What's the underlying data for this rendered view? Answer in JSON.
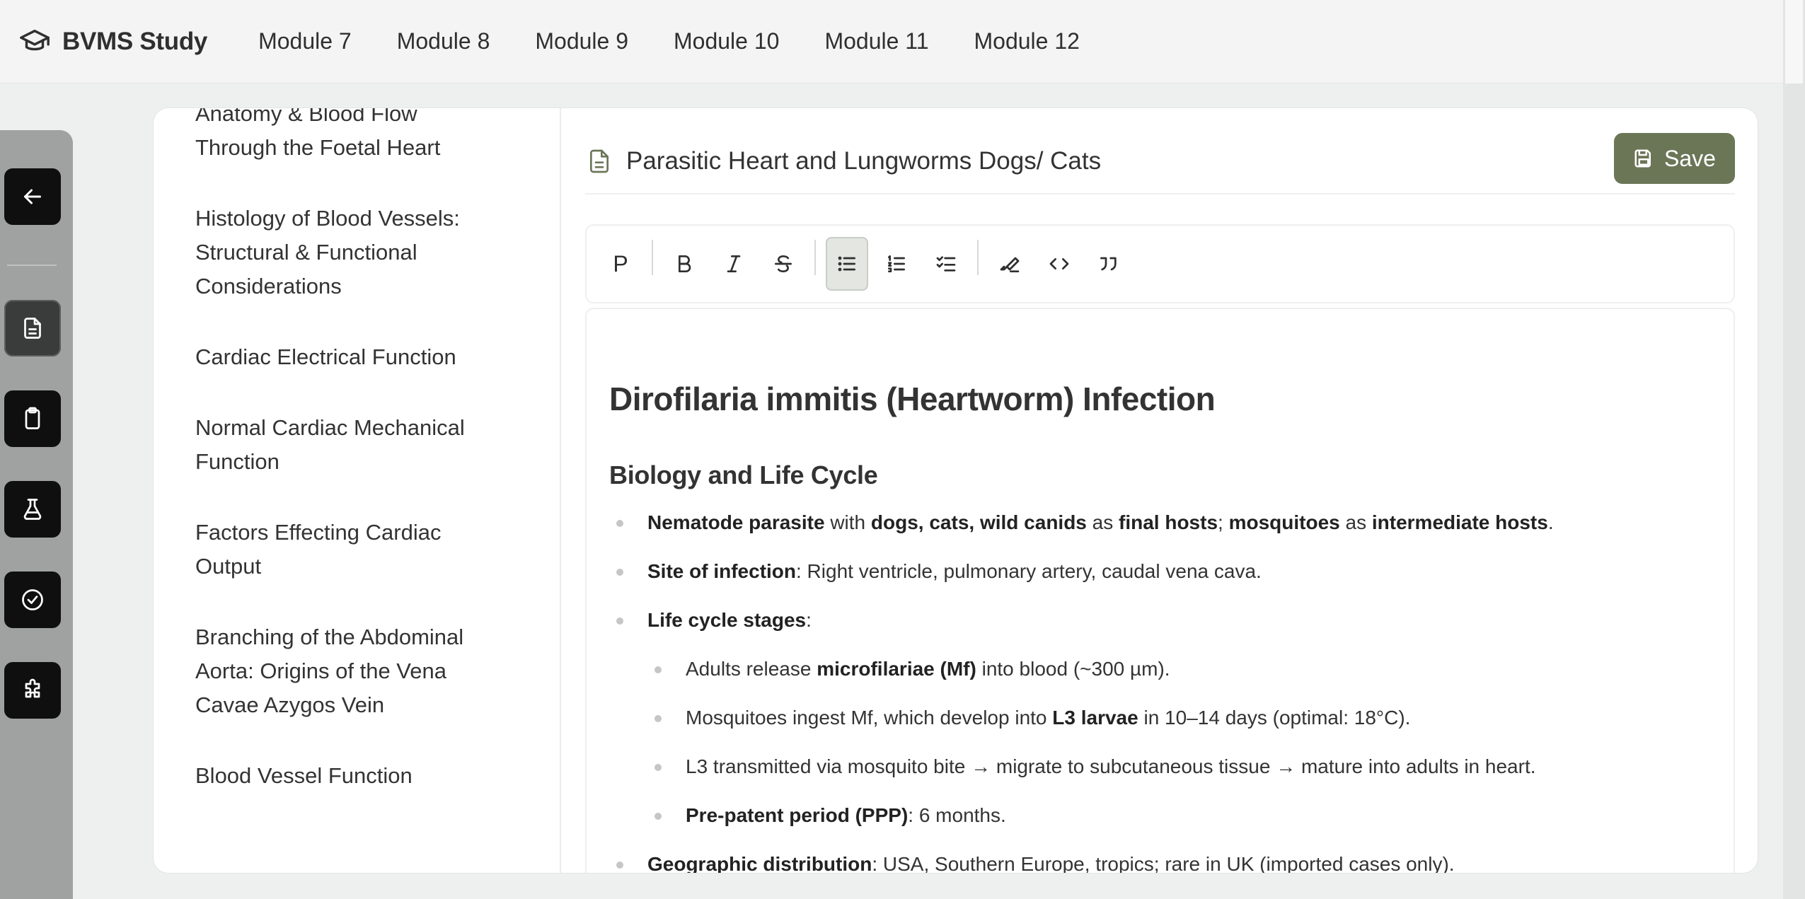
{
  "app": {
    "title": "BVMS Study"
  },
  "nav": [
    "Module 7",
    "Module 8",
    "Module 9",
    "Module 10",
    "Module 11",
    "Module 12"
  ],
  "sidebar": {
    "items": [
      "Anatomy & Blood Flow Through the Foetal Heart",
      "Histology of Blood Vessels: Structural & Functional Considerations",
      "Cardiac Electrical Function",
      "Normal Cardiac Mechanical Function",
      "Factors Effecting Cardiac Output",
      "Branching of the Abdominal Aorta: Origins of the Vena Cavae Azygos Vein",
      "Blood Vessel Function"
    ]
  },
  "document": {
    "title": "Parasitic Heart and Lungworms Dogs/ Cats",
    "save_label": "Save"
  },
  "toolbar": {
    "paragraph": "P"
  },
  "content": {
    "h1": "Dirofilaria immitis (Heartworm) Infection",
    "h2": "Biology and Life Cycle",
    "b1": {
      "b_a": "Nematode parasite",
      "t1": " with ",
      "b_b": "dogs, cats, wild canids",
      "t2": " as ",
      "b_c": "final hosts",
      "t3": "; ",
      "b_d": "mosquitoes",
      "t4": " as ",
      "b_e": "intermediate hosts",
      "t5": "."
    },
    "b2": {
      "b_a": "Site of infection",
      "t1": ": Right ventricle, pulmonary artery, caudal vena cava."
    },
    "b3": {
      "b_a": "Life cycle stages",
      "t1": ":"
    },
    "s1": {
      "t0": "Adults release ",
      "b_a": "microfilariae (Mf)",
      "t1": " into blood (~300 µm)."
    },
    "s2": {
      "t0": "Mosquitoes ingest Mf, which develop into ",
      "b_a": "L3 larvae",
      "t1": " in 10–14 days (optimal: 18°C)."
    },
    "s3": {
      "t0": "L3 transmitted via mosquito bite → migrate to subcutaneous tissue → mature into adults in heart."
    },
    "s4": {
      "b_a": "Pre-patent period (PPP)",
      "t1": ": 6 months."
    },
    "b4": {
      "b_a": "Geographic distribution",
      "t1": ": USA, Southern Europe, tropics; rare in UK (imported cases only)."
    }
  }
}
